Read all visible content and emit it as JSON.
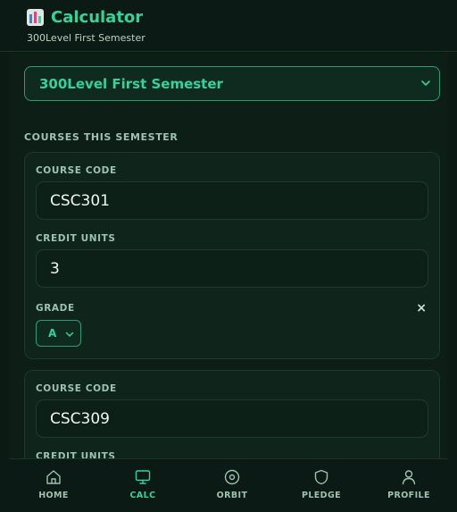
{
  "header": {
    "title": "Calculator",
    "subtitle": "300Level First Semester",
    "icon": "chart-icon"
  },
  "semester_select": {
    "value": "300Level First Semester",
    "icon": "chevron-down-icon"
  },
  "section": {
    "label": "COURSES THIS SEMESTER"
  },
  "courses": [
    {
      "code_label": "COURSE CODE",
      "code": "CSC301",
      "units_label": "CREDIT UNITS",
      "units": "3",
      "grade_label": "GRADE",
      "grade": "A",
      "remove_icon": "×"
    },
    {
      "code_label": "COURSE CODE",
      "code": "CSC309",
      "units_label": "CREDIT UNITS"
    }
  ],
  "nav": {
    "items": [
      {
        "label": "HOME",
        "icon": "home-icon"
      },
      {
        "label": "CALC",
        "icon": "monitor-icon",
        "active": true
      },
      {
        "label": "ORBIT",
        "icon": "target-icon"
      },
      {
        "label": "PLEDGE",
        "icon": "shield-icon"
      },
      {
        "label": "PROFILE",
        "icon": "user-icon"
      }
    ]
  },
  "colors": {
    "accent": "#34d399",
    "background": "#0b1a14",
    "card": "#0f241b",
    "muted": "#9ec2b0"
  }
}
